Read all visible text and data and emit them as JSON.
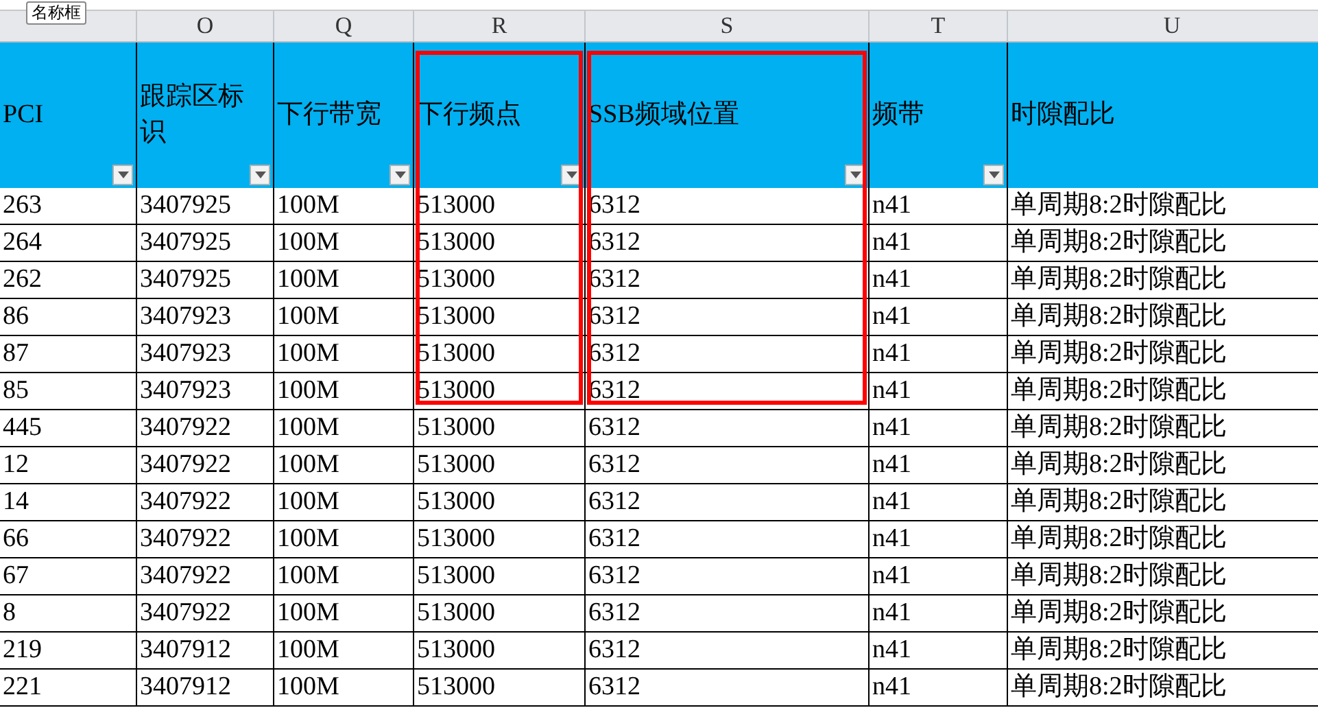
{
  "name_box_tooltip": "名称框",
  "columns": [
    {
      "header": "PCI",
      "filter": true,
      "highlighted": false
    },
    {
      "letter": "O",
      "header": "跟踪区标识",
      "filter": true,
      "highlighted": false
    },
    {
      "letter": "Q",
      "header": "下行带宽",
      "filter": true,
      "highlighted": false
    },
    {
      "letter": "R",
      "header": "下行频点",
      "filter": true,
      "highlighted": true
    },
    {
      "letter": "S",
      "header": "SSB频域位置",
      "filter": true,
      "highlighted": true
    },
    {
      "letter": "T",
      "header": "频带",
      "filter": true,
      "highlighted": false
    },
    {
      "letter": "U",
      "header": "时隙配比",
      "filter": false,
      "highlighted": false
    }
  ],
  "rows": [
    [
      "263",
      "3407925",
      "100M",
      "513000",
      "6312",
      "n41",
      "单周期8:2时隙配比"
    ],
    [
      "264",
      "3407925",
      "100M",
      "513000",
      "6312",
      "n41",
      "单周期8:2时隙配比"
    ],
    [
      "262",
      "3407925",
      "100M",
      "513000",
      "6312",
      "n41",
      "单周期8:2时隙配比"
    ],
    [
      "86",
      "3407923",
      "100M",
      "513000",
      "6312",
      "n41",
      "单周期8:2时隙配比"
    ],
    [
      "87",
      "3407923",
      "100M",
      "513000",
      "6312",
      "n41",
      "单周期8:2时隙配比"
    ],
    [
      "85",
      "3407923",
      "100M",
      "513000",
      "6312",
      "n41",
      "单周期8:2时隙配比"
    ],
    [
      "445",
      "3407922",
      "100M",
      "513000",
      "6312",
      "n41",
      "单周期8:2时隙配比"
    ],
    [
      "12",
      "3407922",
      "100M",
      "513000",
      "6312",
      "n41",
      "单周期8:2时隙配比"
    ],
    [
      "14",
      "3407922",
      "100M",
      "513000",
      "6312",
      "n41",
      "单周期8:2时隙配比"
    ],
    [
      "66",
      "3407922",
      "100M",
      "513000",
      "6312",
      "n41",
      "单周期8:2时隙配比"
    ],
    [
      "67",
      "3407922",
      "100M",
      "513000",
      "6312",
      "n41",
      "单周期8:2时隙配比"
    ],
    [
      "8",
      "3407922",
      "100M",
      "513000",
      "6312",
      "n41",
      "单周期8:2时隙配比"
    ],
    [
      "219",
      "3407912",
      "100M",
      "513000",
      "6312",
      "n41",
      "单周期8:2时隙配比"
    ],
    [
      "221",
      "3407912",
      "100M",
      "513000",
      "6312",
      "n41",
      "单周期8:2时隙配比"
    ]
  ]
}
